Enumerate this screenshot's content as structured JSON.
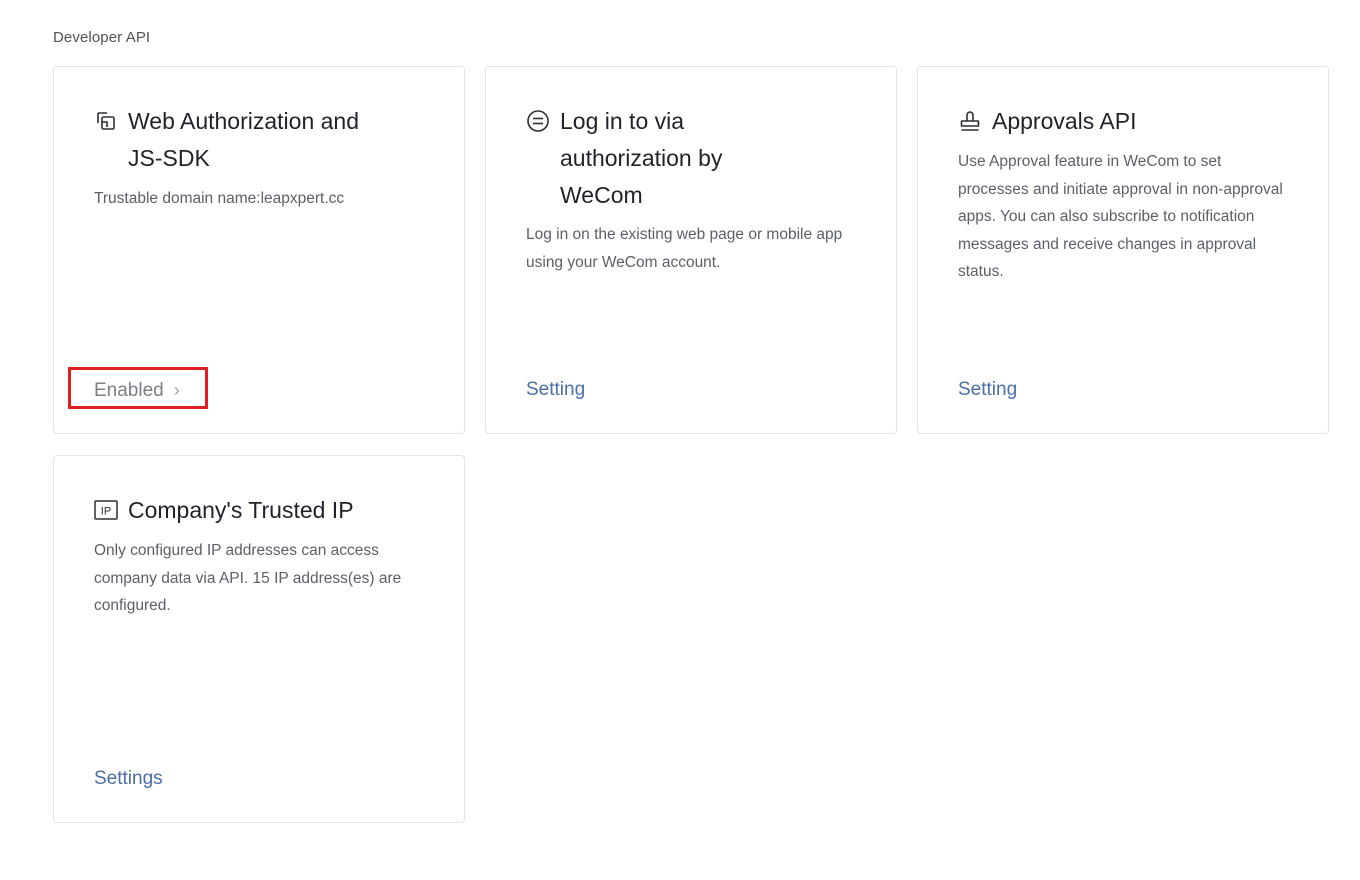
{
  "section": {
    "title": "Developer API"
  },
  "cards": [
    {
      "icon": "web-authorization-icon",
      "title": "Web Authorization and JS-SDK",
      "description": "Trustable domain name:leapxpert.cc",
      "action": "Enabled",
      "action_icon": "chevron-right-icon"
    },
    {
      "icon": "login-authorization-icon",
      "title": "Log in to via authorization by WeCom",
      "description": "Log in on the existing web page or mobile app using your WeCom account.",
      "action": "Setting"
    },
    {
      "icon": "stamp-icon",
      "title": "Approvals API",
      "description": "Use Approval feature in WeCom to set processes and initiate approval in non-approval apps. You can also subscribe to notification messages and receive changes in approval status.",
      "action": "Setting"
    },
    {
      "icon": "ip-icon",
      "title": "Company's Trusted IP",
      "description": "Only configured IP addresses can access company data via API. 15 IP address(es) are configured.",
      "action": "Settings"
    }
  ],
  "colors": {
    "link": "#4a6ea5",
    "enabled_text": "#7b7f85",
    "highlight_border": "#e02020",
    "card_border": "#e3e5e8"
  }
}
